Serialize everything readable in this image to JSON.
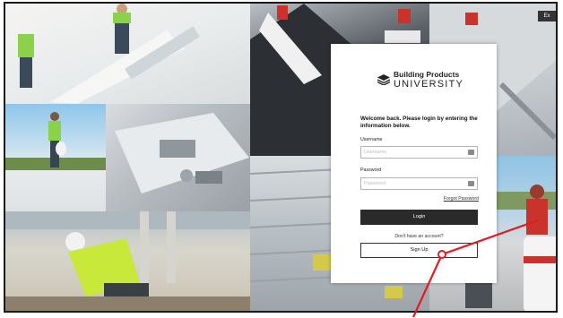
{
  "top_right_tab": {
    "label": "Ex"
  },
  "logo": {
    "line1": "Building Products",
    "line2": "UNIVERSITY"
  },
  "login": {
    "welcome": "Welcome back. Please login by entering the information below.",
    "username_label": "Username",
    "username_placeholder": "Username",
    "password_label": "Password",
    "password_placeholder": "Password",
    "forgot_password": "Forgot Password",
    "login_button": "Login",
    "no_account_text": "Don't have an account?",
    "signup_button": "Sign Up"
  },
  "colors": {
    "annotation": "#e31b23",
    "button_dark": "#2a2a2a"
  }
}
